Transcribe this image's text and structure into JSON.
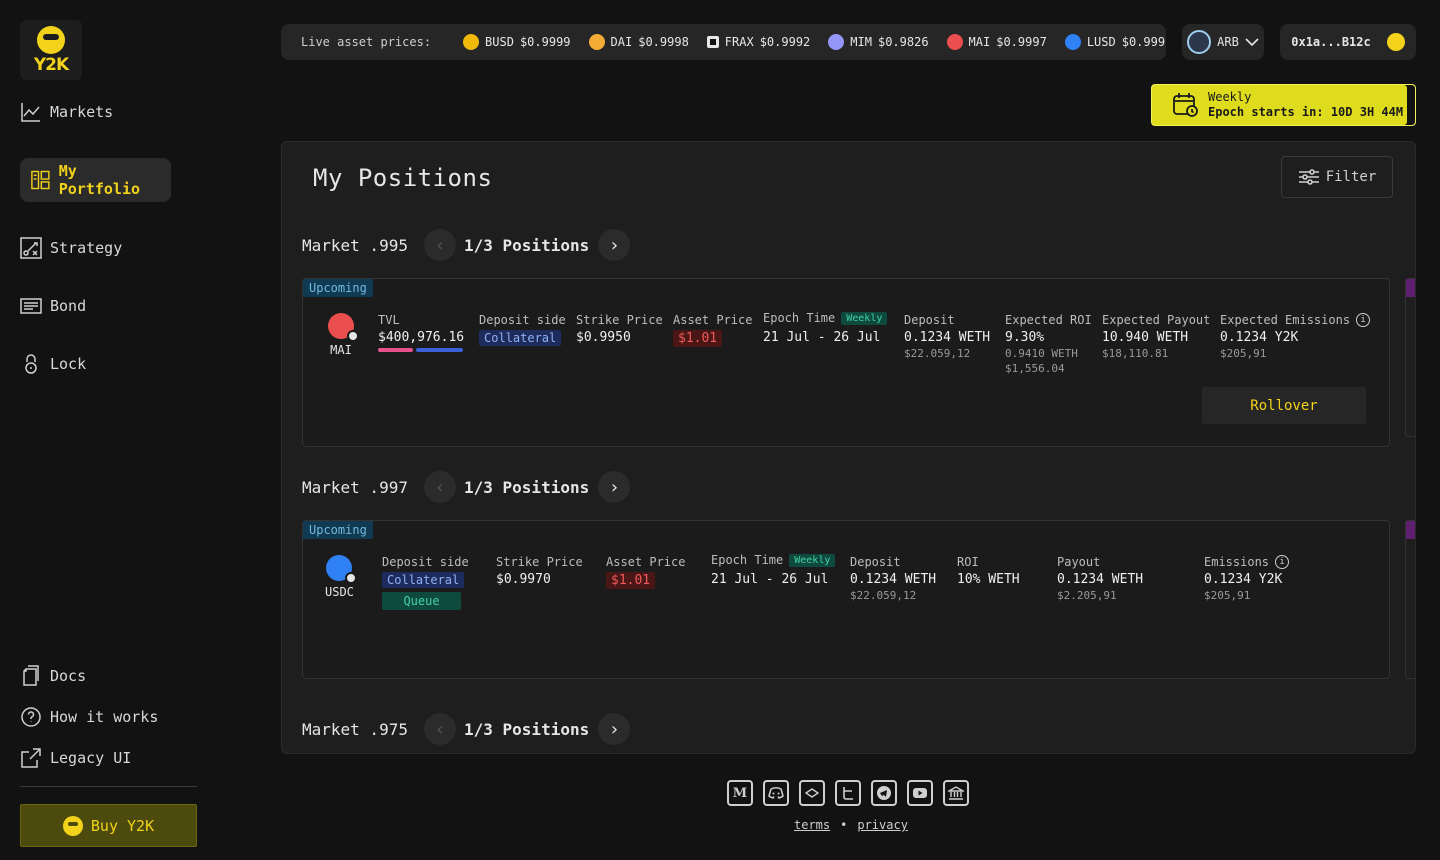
{
  "brand": {
    "logo_text": "Y2K"
  },
  "sidebar": {
    "items": [
      {
        "label": "Markets",
        "icon": "chart-line-icon"
      },
      {
        "label": "My Portfolio",
        "icon": "portfolio-icon",
        "active": true
      },
      {
        "label": "Strategy",
        "icon": "strategy-icon"
      },
      {
        "label": "Bond",
        "icon": "bond-icon"
      },
      {
        "label": "Lock",
        "icon": "lock-icon"
      }
    ],
    "footer_items": [
      {
        "label": "Docs",
        "icon": "docs-icon"
      },
      {
        "label": "How it works",
        "icon": "question-icon"
      },
      {
        "label": "Legacy UI",
        "icon": "external-link-icon"
      }
    ],
    "buy_label": "Buy Y2K"
  },
  "ticker": {
    "label": "Live asset prices:",
    "prices": [
      {
        "symbol": "BUSD",
        "price": "$0.9999",
        "color": "#f0b90b"
      },
      {
        "symbol": "DAI",
        "price": "$0.9998",
        "color": "#f5ac37"
      },
      {
        "symbol": "FRAX",
        "price": "$0.9992",
        "color": "#e6e6e6"
      },
      {
        "symbol": "MIM",
        "price": "$0.9826",
        "color": "#9695f8"
      },
      {
        "symbol": "MAI",
        "price": "$0.9997",
        "color": "#eb4e4e"
      },
      {
        "symbol": "LUSD",
        "price": "$0.999",
        "color": "#2f81f5"
      }
    ]
  },
  "network": {
    "label": "ARB"
  },
  "wallet": {
    "address": "0x1a...B12c"
  },
  "epoch_banner": {
    "line1": "Weekly",
    "line2": "Epoch starts in: 10D 3H 44M"
  },
  "panel": {
    "title": "My Positions",
    "filter_label": "Filter"
  },
  "markets": [
    {
      "label": "Market .995",
      "positions": "1/3 Positions",
      "badge": "Upcoming",
      "asset": {
        "symbol": "MAI",
        "color": "#eb4e4e"
      },
      "tvl": {
        "label": "TVL",
        "value": "$400,976.16",
        "split": 0.42
      },
      "deposit_side": {
        "label": "Deposit side",
        "value": "Collateral"
      },
      "strike": {
        "label": "Strike Price",
        "value": "$0.9950"
      },
      "asset_price": {
        "label": "Asset Price",
        "value": "$1.01"
      },
      "epoch": {
        "label": "Epoch Time",
        "tag": "Weekly",
        "value": "21 Jul - 26 Jul"
      },
      "deposit": {
        "label": "Deposit",
        "value": "0.1234 WETH",
        "sub": "$22.059,12"
      },
      "roi": {
        "label": "Expected ROI",
        "value": "9.30%",
        "sub1": "0.9410 WETH",
        "sub2": "$1,556.04"
      },
      "payout": {
        "label": "Expected Payout",
        "value": "10.940 WETH",
        "sub": "$18,110.81"
      },
      "emissions": {
        "label": "Expected Emissions",
        "value": "0.1234 Y2K",
        "sub": "$205,91"
      },
      "action": "Rollover"
    },
    {
      "label": "Market .997",
      "positions": "1/3 Positions",
      "badge": "Upcoming",
      "asset": {
        "symbol": "USDC",
        "color": "#2f81f5"
      },
      "deposit_side": {
        "label": "Deposit side",
        "value": "Collateral",
        "status": "Queue"
      },
      "strike": {
        "label": "Strike Price",
        "value": "$0.9970"
      },
      "asset_price": {
        "label": "Asset Price",
        "value": "$1.01"
      },
      "epoch": {
        "label": "Epoch Time",
        "tag": "Weekly",
        "value": "21 Jul - 26 Jul"
      },
      "deposit": {
        "label": "Deposit",
        "value": "0.1234 WETH",
        "sub": "$22.059,12"
      },
      "roi": {
        "label": "ROI",
        "value": "10% WETH"
      },
      "payout": {
        "label": "Payout",
        "value": "0.1234 WETH",
        "sub": "$2.205,91"
      },
      "emissions": {
        "label": "Emissions",
        "value": "0.1234 Y2K",
        "sub": "$205,91"
      }
    },
    {
      "label": "Market .975",
      "positions": "1/3 Positions"
    }
  ],
  "footer": {
    "icons": [
      "medium-icon",
      "discord-icon",
      "gitbook-icon",
      "twitter-icon",
      "telegram-icon",
      "youtube-icon",
      "bank-icon"
    ],
    "terms": "terms",
    "separator": "•",
    "privacy": "privacy"
  },
  "colors": {
    "accent": "#f2d21a",
    "background": "#121212",
    "panel": "#1e1e1e"
  }
}
